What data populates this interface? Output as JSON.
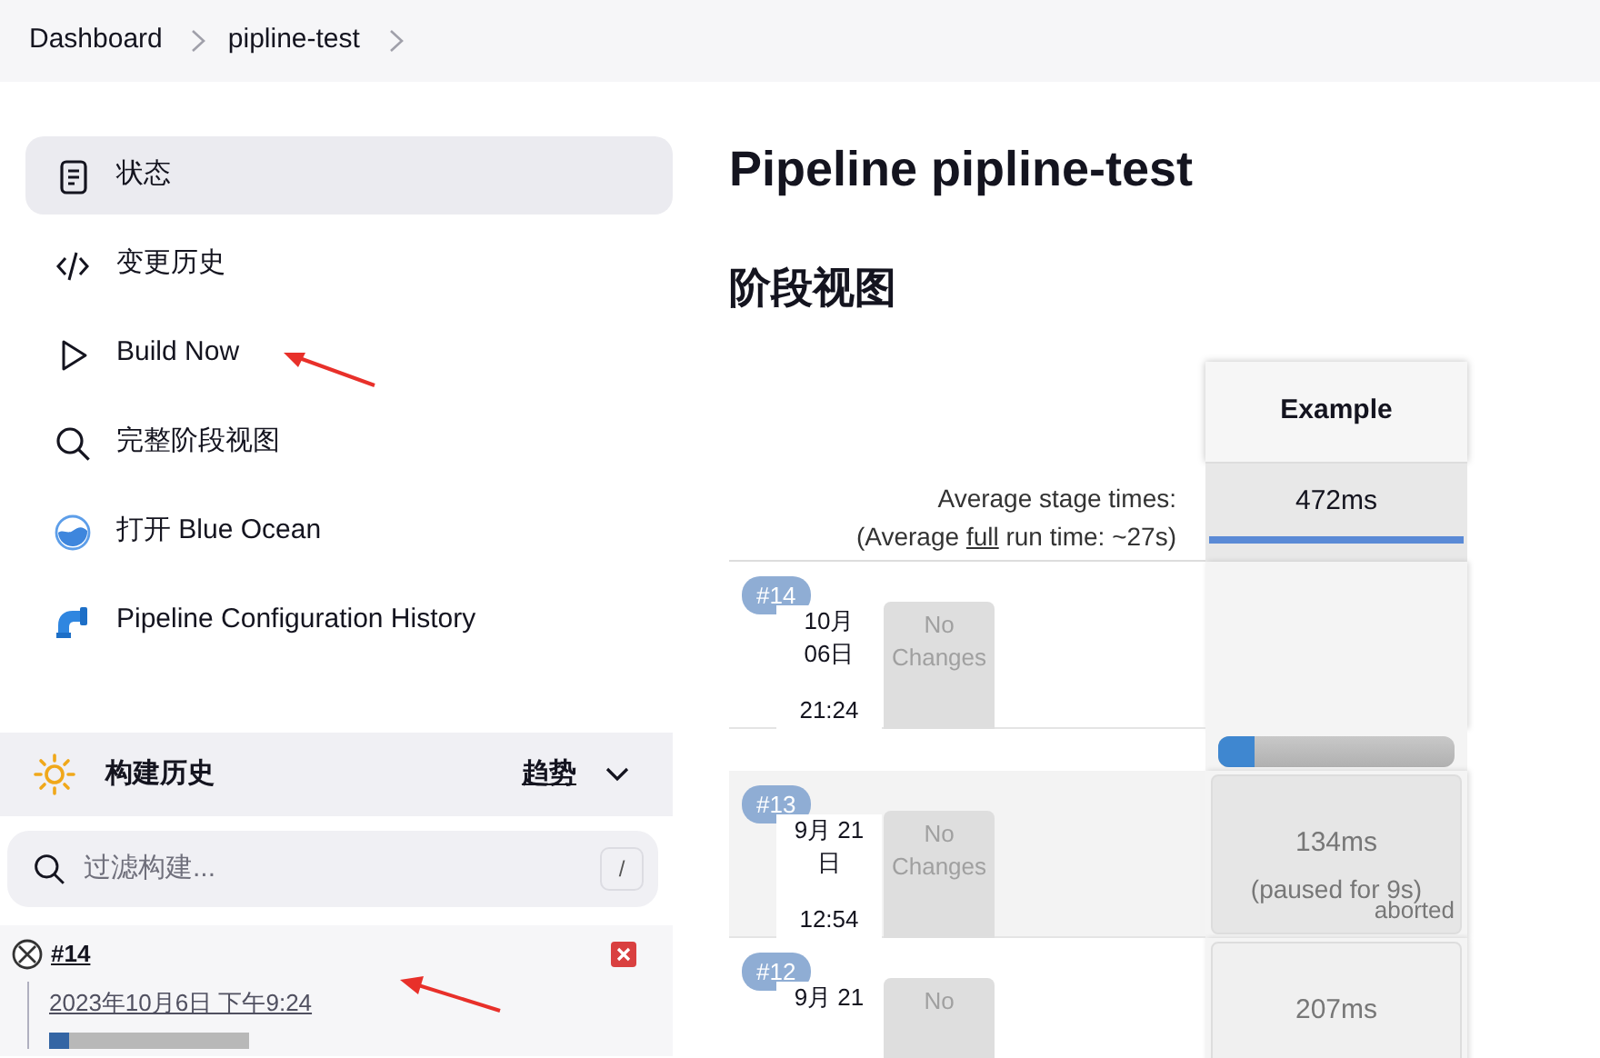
{
  "breadcrumbs": [
    "Dashboard",
    "pipline-test"
  ],
  "sidebar": {
    "items": [
      {
        "label": "状态",
        "selected": true
      },
      {
        "label": "变更历史",
        "selected": false
      },
      {
        "label": "Build Now",
        "selected": false
      },
      {
        "label": "完整阶段视图",
        "selected": false
      },
      {
        "label": "打开 Blue Ocean",
        "selected": false
      },
      {
        "label": "Pipeline Configuration History",
        "selected": false
      }
    ]
  },
  "build_history": {
    "title": "构建历史",
    "trend": "趋势",
    "filter": {
      "placeholder": "过滤构建...",
      "shortcut": "/"
    },
    "builds": [
      {
        "number": "#14",
        "aborted": true,
        "date": "2023年10月6日 下午9:24",
        "level": 0.1
      }
    ]
  },
  "title": "Pipeline pipline-test",
  "stage_view": {
    "title": "阶段视图",
    "stage": "Example",
    "average_label": "Average stage times:",
    "average_full_pre": "(Average ",
    "average_full_link": "full",
    "average_full_post": " run time: ~27s)",
    "average_time": "472ms",
    "runs": [
      {
        "number": "#14",
        "date": "10月 06日",
        "time": "21:24",
        "changes": "No Changes",
        "stage": {
          "kind": "running",
          "level": 0.15
        }
      },
      {
        "number": "#13",
        "date": "9月 21 日",
        "time": "12:54",
        "changes": "No Changes",
        "stage": {
          "kind": "aborted",
          "duration": "134ms",
          "note": "(paused for 9s)",
          "status": "aborted"
        }
      },
      {
        "number": "#12",
        "date": "9月 21",
        "changes": "No",
        "stage": {
          "kind": "done",
          "duration": "207ms"
        }
      }
    ]
  }
}
